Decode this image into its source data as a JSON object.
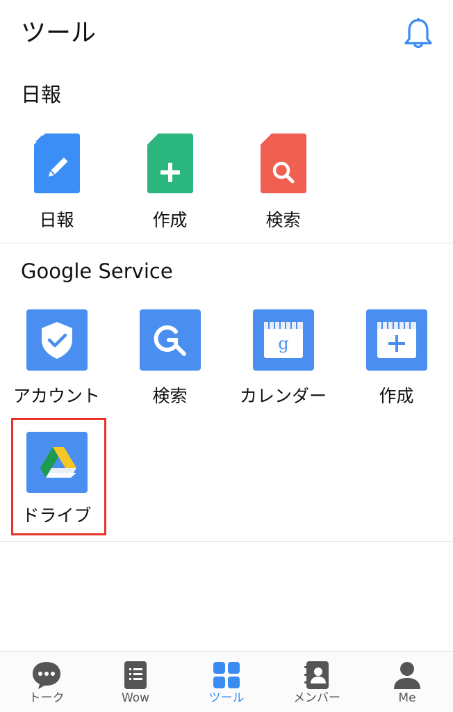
{
  "header": {
    "title": "ツール"
  },
  "sections": {
    "nippo": {
      "title": "日報",
      "items": [
        {
          "label": "日報",
          "icon": "pencil-document-icon",
          "color": "#3a8ef6"
        },
        {
          "label": "作成",
          "icon": "plus-document-icon",
          "color": "#2bb67f"
        },
        {
          "label": "検索",
          "icon": "search-document-icon",
          "color": "#ef5f52"
        }
      ]
    },
    "google": {
      "title": "Google Service",
      "items": [
        {
          "label": "アカウント",
          "icon": "shield-check-icon",
          "color": "#4a8ef0"
        },
        {
          "label": "検索",
          "icon": "google-search-icon",
          "color": "#4a8ef0"
        },
        {
          "label": "カレンダー",
          "icon": "calendar-g-icon",
          "color": "#4a8ef0"
        },
        {
          "label": "作成",
          "icon": "calendar-plus-icon",
          "color": "#4a8ef0"
        },
        {
          "label": "ドライブ",
          "icon": "google-drive-icon",
          "color": "#4a8ef0"
        }
      ]
    }
  },
  "tabs": [
    {
      "label": "トーク",
      "icon": "chat-bubble-icon",
      "active": false
    },
    {
      "label": "Wow",
      "icon": "note-list-icon",
      "active": false
    },
    {
      "label": "ツール",
      "icon": "grid-icon",
      "active": true
    },
    {
      "label": "メンバー",
      "icon": "contacts-icon",
      "active": false
    },
    {
      "label": "Me",
      "icon": "person-icon",
      "active": false
    }
  ],
  "colors": {
    "accent": "#3b8cf0",
    "highlight": "#e8322a",
    "tab_inactive": "#555555"
  }
}
